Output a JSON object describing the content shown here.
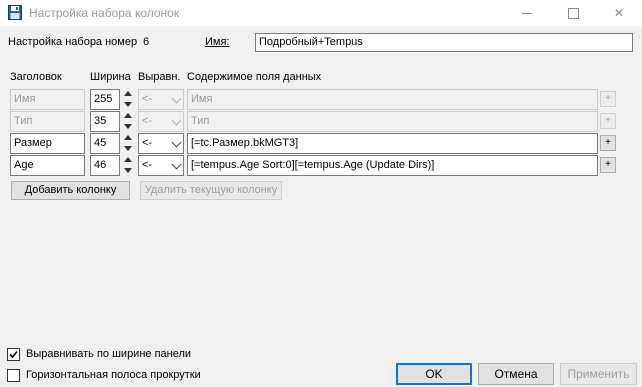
{
  "window": {
    "title": "Настройка набора колонок",
    "close_glyph": "✕"
  },
  "header": {
    "set_label": "Настройка набора номер",
    "set_number": "6",
    "name_label": "Имя:",
    "name_value": "Подробный+Tempus"
  },
  "columns_header": {
    "title": "Заголовок",
    "width": "Ширина",
    "align": "Выравн.",
    "content": "Содержимое поля данных"
  },
  "rows": [
    {
      "title": "Имя",
      "width": "255",
      "align": "<-",
      "content": "Имя",
      "plus": "+"
    },
    {
      "title": "Тип",
      "width": "35",
      "align": "<-",
      "content": "Тип",
      "plus": "+"
    },
    {
      "title": "Размер",
      "width": "45",
      "align": "<-",
      "content": "[=tc.Размер.bkMGT3]",
      "plus": "+"
    },
    {
      "title": "Age",
      "width": "46",
      "align": "<-",
      "content": "[=tempus.Age Sort:0][=tempus.Age (Update Dirs)]",
      "plus": "+"
    }
  ],
  "actions": {
    "add_column": "Добавить колонку",
    "delete_column": "Удалить текущую колонку"
  },
  "options": {
    "fit_width": {
      "label": "Выравнивать по ширине панели",
      "checked": true
    },
    "hscroll": {
      "label": "Горизонтальная полоса прокрутки",
      "checked": false
    }
  },
  "footer": {
    "ok": "OK",
    "cancel": "Отмена",
    "apply": "Применить"
  },
  "colors": {
    "accent": "#0078d7",
    "disabled_text": "#9a9a9a"
  }
}
